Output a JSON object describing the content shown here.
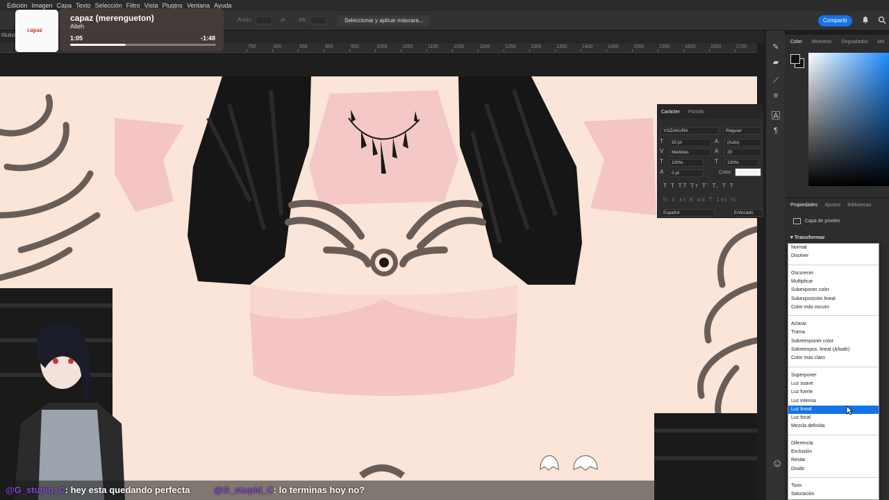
{
  "app": {
    "menu": [
      "Edición",
      "Imagen",
      "Capa",
      "Texto",
      "Selección",
      "Filtro",
      "Vista",
      "Plugins",
      "Ventana",
      "Ayuda"
    ],
    "options": {
      "width_label": "Anch:",
      "height_label": "Alt:",
      "mask_button": "Seleccionar y aplicar máscara..."
    },
    "share_label": "Compartir",
    "doc_tab": "títulos",
    "ruler_labels": [
      "750",
      "800",
      "850",
      "900",
      "950",
      "1000",
      "1050",
      "1100",
      "1150",
      "1200",
      "1250",
      "1300",
      "1350",
      "1400",
      "1450",
      "1500",
      "1550",
      "1600",
      "1650",
      "1700"
    ]
  },
  "music": {
    "album_text": "capaz",
    "title": "capaz (merengueton)",
    "artist": "Alleh",
    "elapsed": "1:05",
    "remaining": "-1:48",
    "progress": 0.38
  },
  "character": {
    "tabs": [
      "Carácter",
      "Párrafo"
    ],
    "font_family": "YOZAKURA",
    "font_style": "Regular",
    "font_size": "50 pt",
    "leading": "(Auto)",
    "kerning": "Medidas",
    "tracking": "20",
    "vertical_scale": "100%",
    "horizontal_scale": "100%",
    "baseline": "0 pt",
    "color_label": "Color:",
    "typo_buttons": "T  T  TT  Tт  T'  T,  T  T",
    "opentype_buttons": "fi  σ  st  A  ad  T  1st  ½",
    "language": "Español",
    "antialias": "Enfocado"
  },
  "color_panel": {
    "tabs": [
      "Color",
      "Muestras",
      "Degradados",
      "Mo"
    ]
  },
  "properties": {
    "tabs": [
      "Propiedades",
      "Ajustes",
      "Bibliotecas"
    ],
    "layer_type": "Capa de píxeles",
    "section": "Transformar"
  },
  "blend_modes": {
    "selected": "Luz lineal",
    "groups": [
      [
        "Normal",
        "Disolver"
      ],
      [
        "Oscurecer",
        "Multiplicar",
        "Subexponer color",
        "Subexposición lineal",
        "Color más oscuro"
      ],
      [
        "Aclarar",
        "Trama",
        "Sobreexponer color",
        "Sobreexpos. lineal (Añadir)",
        "Color más claro"
      ],
      [
        "Superponer",
        "Luz suave",
        "Luz fuerte",
        "Luz intensa",
        "Luz lineal",
        "Luz focal",
        "Mezcla definida"
      ],
      [
        "Diferencia",
        "Exclusión",
        "Restar",
        "Dividir"
      ],
      [
        "Tono",
        "Saturación"
      ]
    ]
  },
  "chat": [
    {
      "user": "@G_stupid_C",
      "message": ": hey esta quedando perfecta"
    },
    {
      "user": "@G_stupid_C",
      "message": ": lo terminas hoy no?"
    }
  ],
  "colors": {
    "accent": "#1473e6",
    "skin": "#fbe4d8",
    "chat_user": "#8a4bd1"
  }
}
